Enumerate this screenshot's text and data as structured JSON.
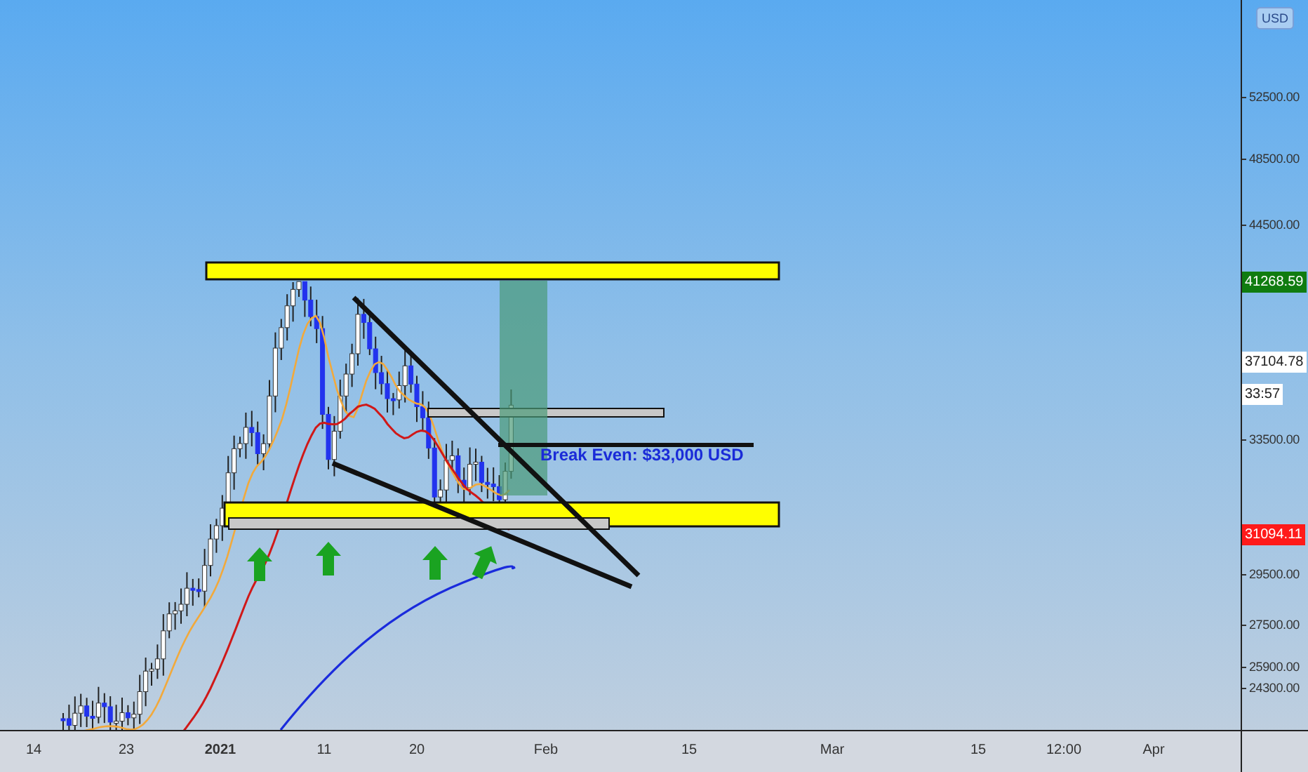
{
  "chart": {
    "annotation": "Break Even: $33,000 USD"
  },
  "price_axis": {
    "currency": "USD",
    "ticks": [
      "52500.00",
      "48500.00",
      "44500.00",
      "33500.00",
      "29500.00",
      "27500.00",
      "25900.00",
      "24300.00"
    ],
    "badges": [
      {
        "text": "41268.59",
        "color": "#107c10"
      },
      {
        "text": "37104.78",
        "color": "#ffffff"
      },
      {
        "text": "33:57",
        "color": "#ffffff"
      },
      {
        "text": "31094.11",
        "color": "#ff1a1a"
      }
    ]
  },
  "time_axis": {
    "ticks": [
      {
        "label": "14",
        "bold": false
      },
      {
        "label": "23",
        "bold": false
      },
      {
        "label": "2021",
        "bold": true
      },
      {
        "label": "11",
        "bold": false
      },
      {
        "label": "20",
        "bold": false
      },
      {
        "label": "Feb",
        "bold": false
      },
      {
        "label": "15",
        "bold": false
      },
      {
        "label": "Mar",
        "bold": false
      },
      {
        "label": "15",
        "bold": false
      },
      {
        "label": "12:00",
        "bold": false
      },
      {
        "label": "Apr",
        "bold": false
      }
    ]
  }
}
